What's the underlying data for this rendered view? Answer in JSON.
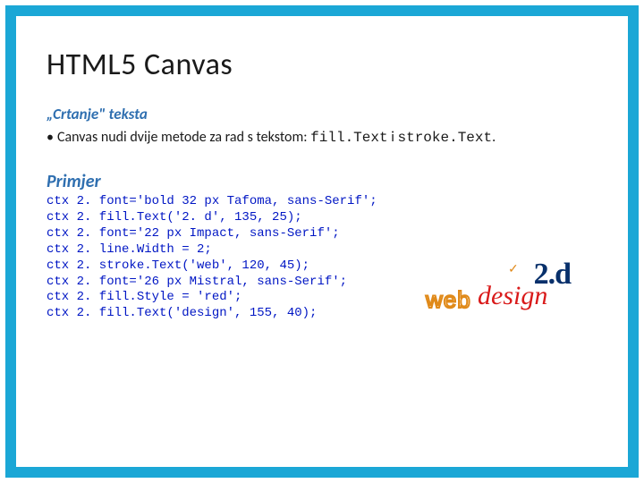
{
  "title": "HTML5 Canvas",
  "subheading": "„Crtanje\" teksta",
  "bullet": {
    "dot": "•",
    "lead": "Canvas nudi dvije metode za rad s tekstom: ",
    "m1": "fill.Text",
    "sep": " i ",
    "m2": " stroke.Text",
    "end": "."
  },
  "exampleLabel": "Primjer",
  "code": "ctx 2. font='bold 32 px Tafoma, sans-Serif';\nctx 2. fill.Text('2. d', 135, 25);\nctx 2. font='22 px Impact, sans-Serif';\nctx 2. line.Width = 2;\nctx 2. stroke.Text('web', 120, 45);\nctx 2. font='26 px Mistral, sans-Serif';\nctx 2. fill.Style = 'red';\nctx 2. fill.Text('design', 155, 40);",
  "demo": {
    "t2d": "2.d",
    "web": "web",
    "design": "design",
    "tick": "✓"
  }
}
